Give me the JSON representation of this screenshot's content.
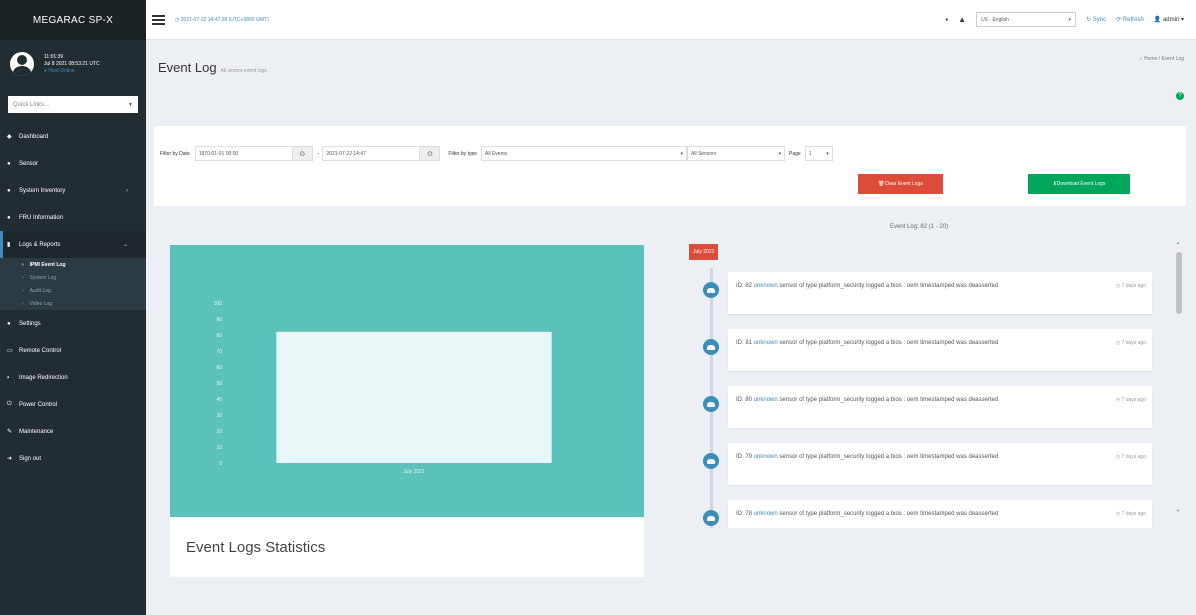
{
  "app": {
    "brand": "MEGARAC SP-X"
  },
  "user": {
    "name": "11:01:39",
    "login_time": "Jul 8 2021 08:53:21 UTC",
    "status": "Host Online"
  },
  "quick_select": {
    "placeholder": "Quick Links..."
  },
  "sidebar": {
    "items": [
      {
        "icon": "dashboard-icon",
        "glyph": "◆",
        "label": "Dashboard"
      },
      {
        "icon": "sensor-icon",
        "glyph": "●",
        "label": "Sensor"
      },
      {
        "icon": "inventory-icon",
        "glyph": "●",
        "label": "System Inventory",
        "arrow": "›"
      },
      {
        "icon": "fru-icon",
        "glyph": "●",
        "label": "FRU Information"
      },
      {
        "icon": "logs-icon",
        "glyph": "▮",
        "label": "Logs & Reports",
        "arrow": "⌄"
      },
      {
        "icon": "settings-icon",
        "glyph": "●",
        "label": "Settings"
      },
      {
        "icon": "remote-control-icon",
        "glyph": "▭",
        "label": "Remote Control"
      },
      {
        "icon": "image-redirection-icon",
        "glyph": "▪",
        "label": "Image Redirection"
      },
      {
        "icon": "power-icon",
        "glyph": "⏻",
        "label": "Power Control"
      },
      {
        "icon": "maintenance-icon",
        "glyph": "✎",
        "label": "Maintenance"
      },
      {
        "icon": "signout-icon",
        "glyph": "➜",
        "label": "Sign out"
      }
    ],
    "submenu": [
      {
        "label": "IPMI Event Log",
        "current": true
      },
      {
        "label": "System Log",
        "current": false
      },
      {
        "label": "Audit Log",
        "current": false
      },
      {
        "label": "Video Log",
        "current": false
      }
    ]
  },
  "header": {
    "datetime": "2021-07-22 14:47:28 (UTC+0800 GMT)",
    "language": "US - English",
    "sync": "Sync",
    "refresh": "Refresh",
    "user": "admin"
  },
  "page": {
    "title": "Event Log",
    "subtitle": "All sensor event logs",
    "breadcrumb_home": "Home",
    "breadcrumb_current": "Event Log"
  },
  "filters": {
    "by_date_label": "Filter by Date",
    "start_date": "1970-01-01 00:00",
    "end_date": "2021-07-22 14:47",
    "by_type_label": "Filter by type",
    "type_value": "All Events",
    "sensor_value": "All Sensors",
    "page_label": "Page",
    "page_value": "1"
  },
  "buttons": {
    "clear": "Clear Event Logs",
    "download": "Download Event Logs"
  },
  "event_count": "Event Log: 82 (1 - 20)",
  "chart_data": {
    "type": "bar",
    "categories": [
      "July 2021"
    ],
    "values": [
      82
    ],
    "ylim": [
      0,
      100
    ],
    "yticks": [
      "0",
      "10",
      "20",
      "30",
      "40",
      "50",
      "60",
      "70",
      "80",
      "90",
      "100"
    ],
    "title": "",
    "xlabel": "",
    "ylabel": "",
    "background": "#5bc3bb",
    "bar_color": "#e8f6f5"
  },
  "chart_caption": "Event Logs Statistics",
  "timeline": {
    "date_label": "July 2021",
    "events": [
      {
        "id_text": "ID: 82",
        "source": "unknown",
        "text": "sensor of type platform_security logged a bios : oem timestamped was deasserted",
        "time": "7 days ago"
      },
      {
        "id_text": "ID: 81",
        "source": "unknown",
        "text": "sensor of type platform_security logged a bios : oem timestamped was deasserted",
        "time": "7 days ago"
      },
      {
        "id_text": "ID: 80",
        "source": "unknown",
        "text": "sensor of type platform_security logged a bios : oem timestamped was deasserted",
        "time": "7 days ago"
      },
      {
        "id_text": "ID: 79",
        "source": "unknown",
        "text": "sensor of type platform_security logged a bios : oem timestamped was deasserted",
        "time": "7 days ago"
      },
      {
        "id_text": "ID: 78",
        "source": "unknown",
        "text": "sensor of type platform_security logged a bios : oem timestamped was deasserted",
        "time": "7 days ago"
      }
    ]
  }
}
